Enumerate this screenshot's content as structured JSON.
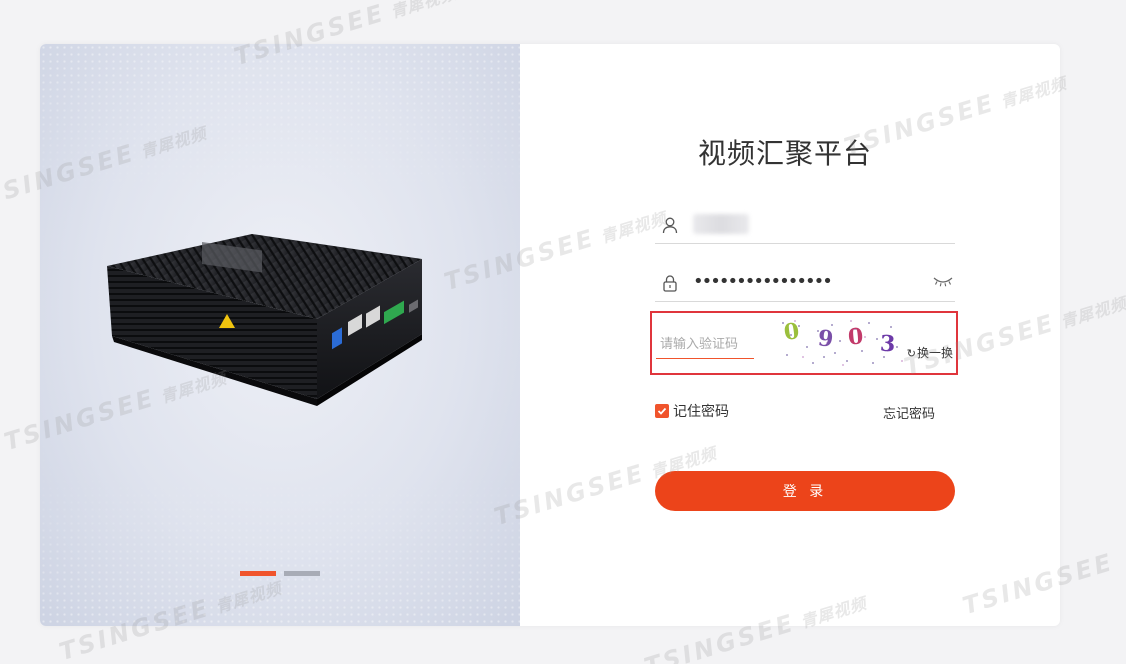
{
  "page": {
    "title": "视频汇聚平台",
    "watermark": {
      "latin": "TSINGSEE",
      "cn": "青犀视频"
    }
  },
  "carousel": {
    "slides": 2,
    "active_index": 0,
    "accent_color": "#f0542c"
  },
  "login": {
    "username": {
      "value": "",
      "icon": "user-icon"
    },
    "password": {
      "value": "••••••••••••••••",
      "icon": "lock-icon",
      "toggle_icon": "eye-closed-icon"
    },
    "captcha": {
      "placeholder": "请输入验证码",
      "characters": [
        "0",
        "9",
        "0",
        "3"
      ],
      "refresh_label": "换一换",
      "refresh_icon": "refresh-icon"
    },
    "remember": {
      "label": "记住密码",
      "checked": true
    },
    "forgot_label": "忘记密码",
    "submit_label": "登 录",
    "button_color": "#ec441a"
  }
}
